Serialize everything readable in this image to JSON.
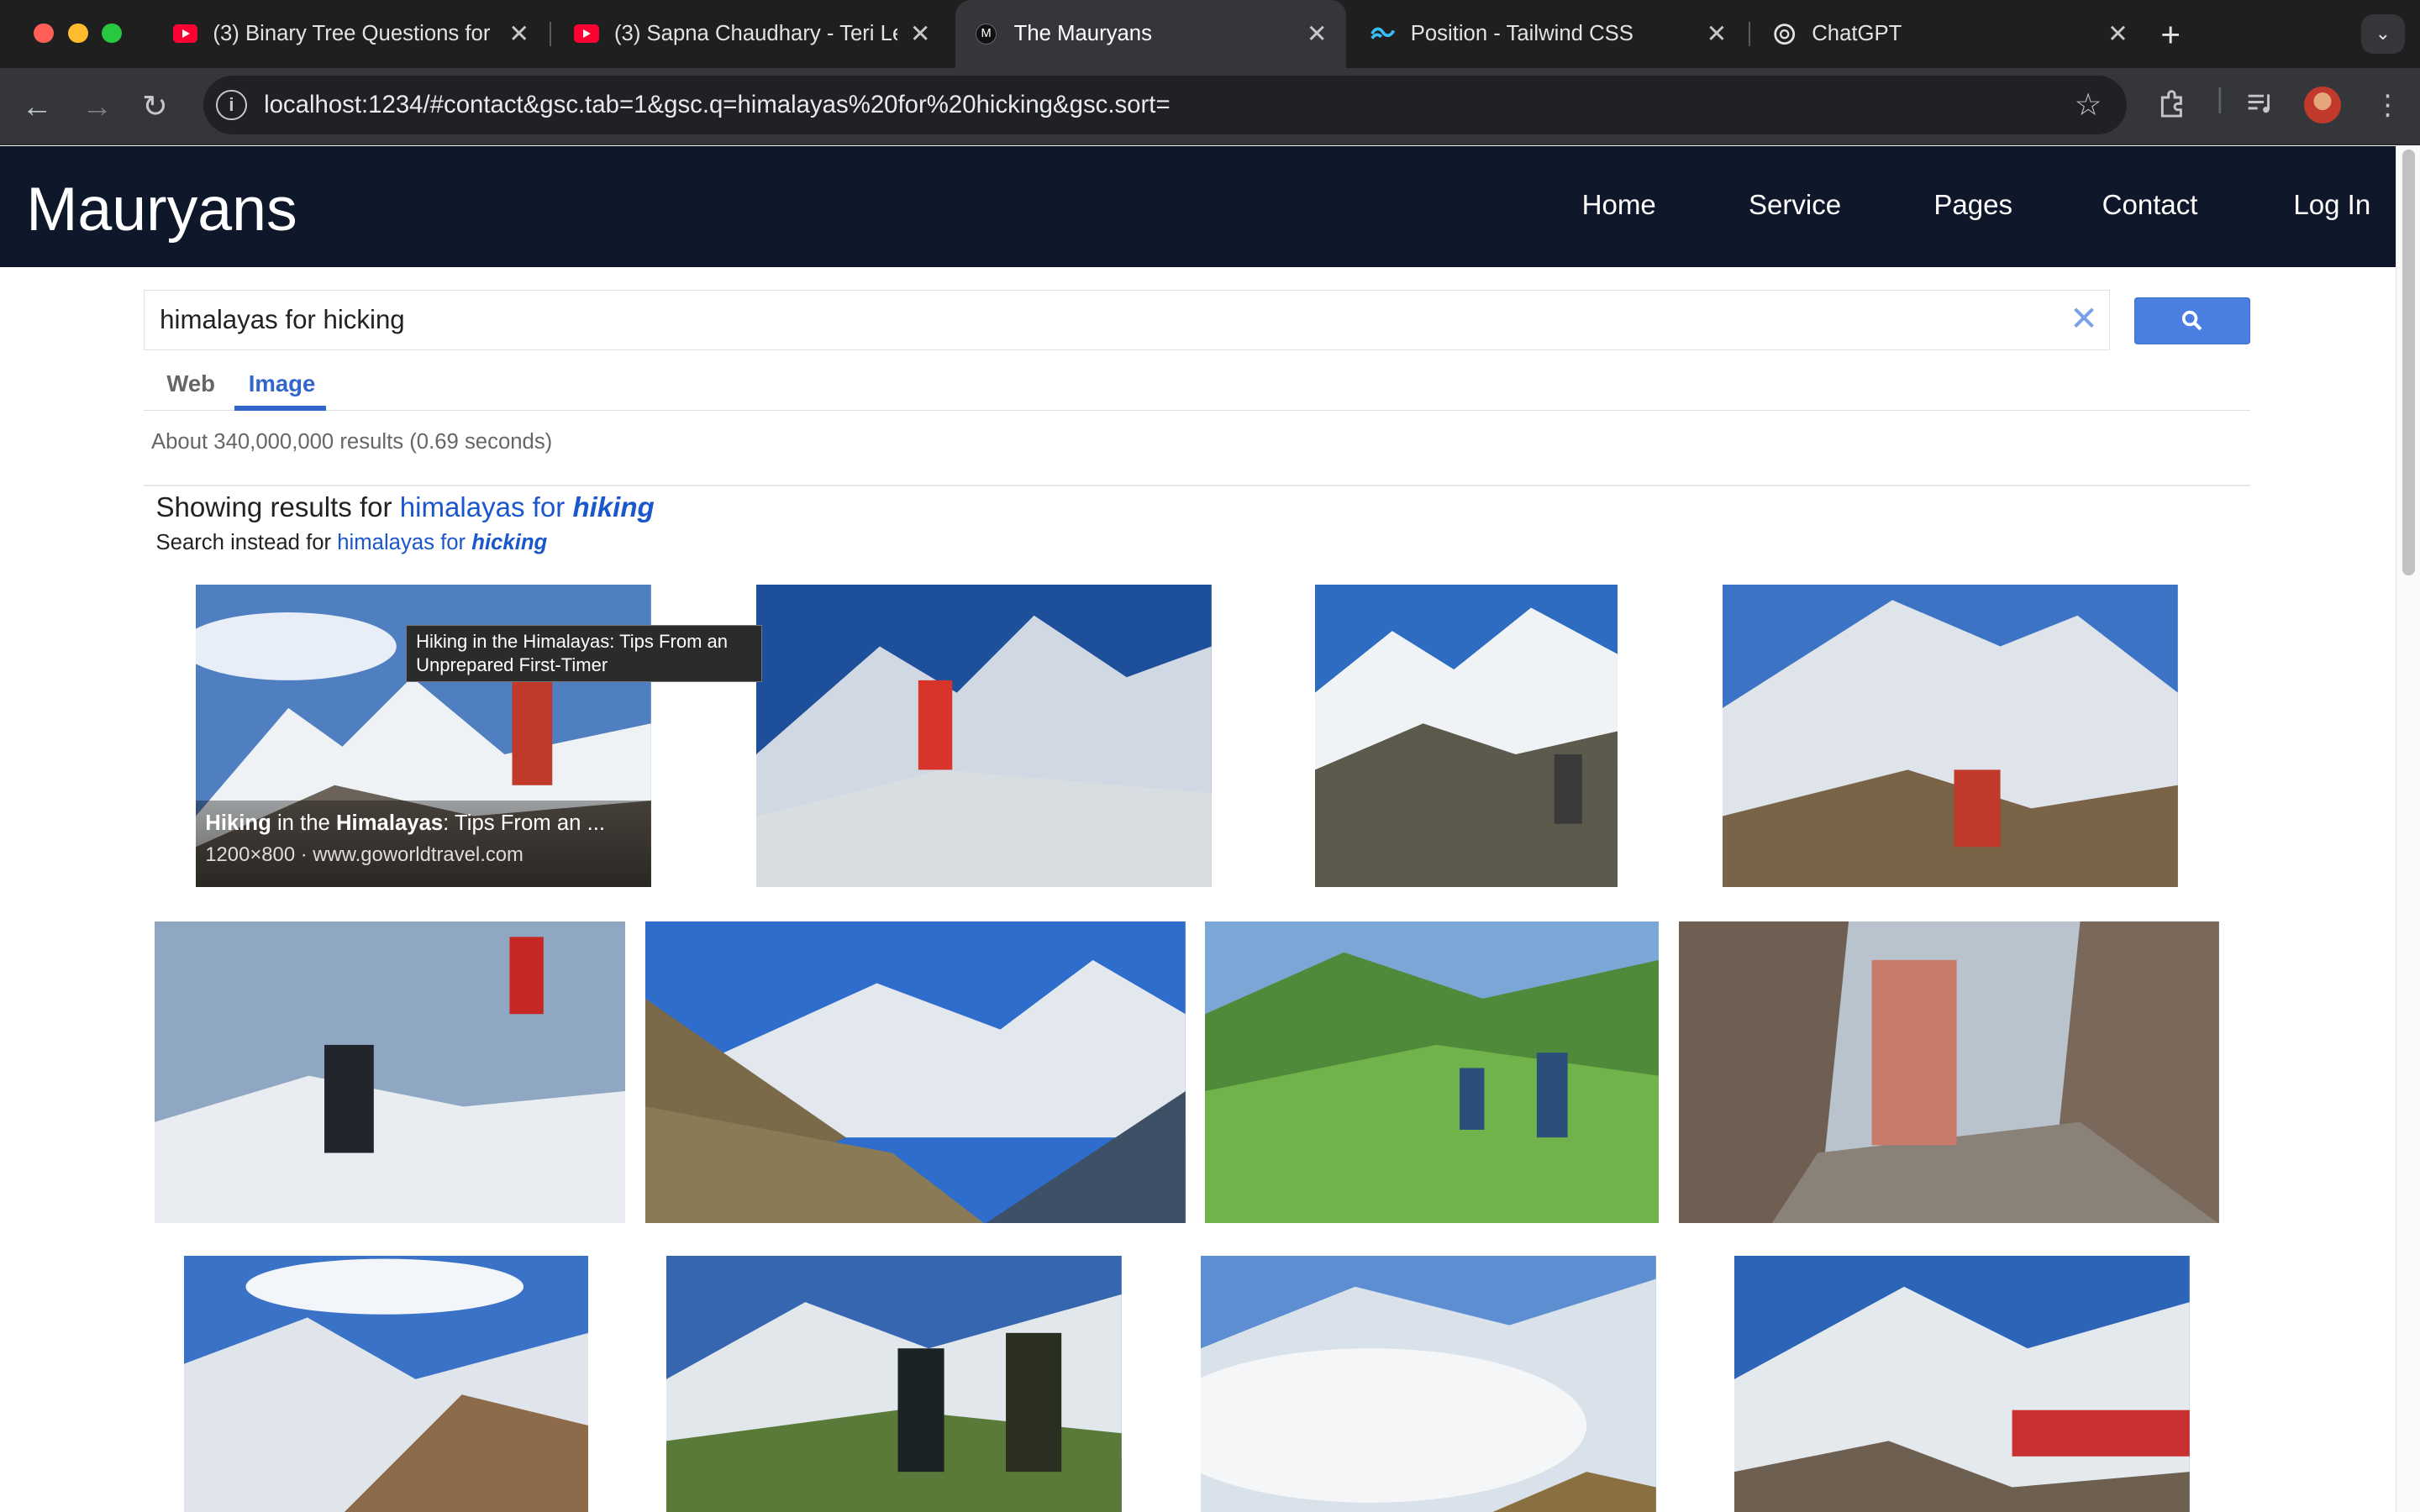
{
  "browser": {
    "tabs": [
      {
        "title": "(3) Binary Tree Questions for",
        "icon": "youtube-icon"
      },
      {
        "title": "(3) Sapna Chaudhary - Teri Le",
        "icon": "youtube-icon"
      },
      {
        "title": "The Mauryans",
        "icon": "site-icon",
        "active": true
      },
      {
        "title": "Position - Tailwind CSS",
        "icon": "tailwind-icon"
      },
      {
        "title": "ChatGPT",
        "icon": "chatgpt-icon"
      }
    ],
    "url": "localhost:1234/#contact&gsc.tab=1&gsc.q=himalayas%20for%20hicking&gsc.sort=",
    "new_tab": "+",
    "tab_menu": "⌄"
  },
  "site": {
    "logo": "Mauryans",
    "nav": [
      "Home",
      "Service",
      "Pages",
      "Contact",
      "Log In"
    ]
  },
  "search": {
    "query": "himalayas for hicking",
    "tabs": [
      "Web",
      "Image"
    ],
    "selected_tab": "Image",
    "result_count": "About 340,000,000 results (0.69 seconds)",
    "showing_prefix": "Showing results for",
    "corrected_plain": "himalayas for ",
    "corrected_bold": "hiking",
    "instead_prefix": "Search instead for",
    "instead_plain": "himalayas for ",
    "instead_bold": "hicking"
  },
  "results": {
    "hover": {
      "title_b1": "Hiking",
      "title_t1": " in the ",
      "title_b2": "Himalayas",
      "title_t2": ": Tips From an ...",
      "meta": "1200×800 · www.goworldtravel.com",
      "tooltip": "Hiking in the Himalayas: Tips From an Unprepared First-Timer"
    }
  },
  "colors": {
    "header_bg": "#0f172a",
    "link": "#1a56cc",
    "search_button": "#4a7ee0"
  }
}
